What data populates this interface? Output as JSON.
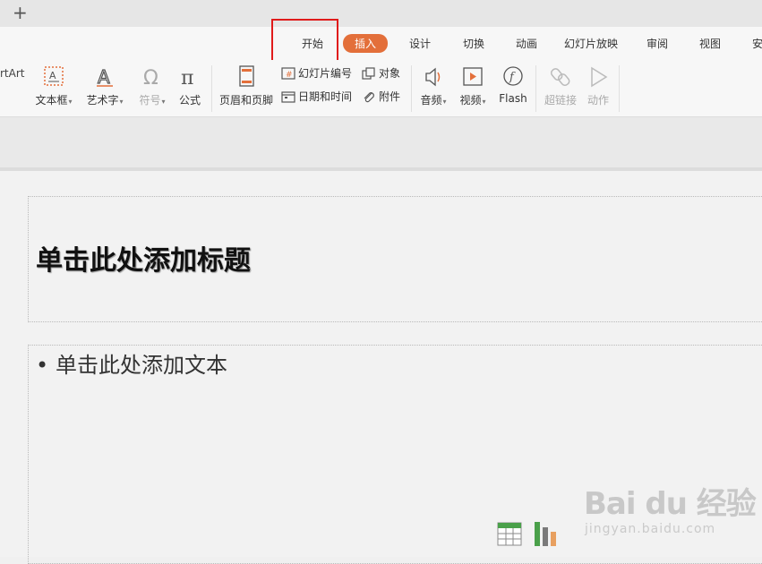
{
  "tabbar": {
    "new_tab_symbol": "+"
  },
  "ribbon_tabs": [
    "开始",
    "插入",
    "设计",
    "切换",
    "动画",
    "幻灯片放映",
    "审阅",
    "视图",
    "安"
  ],
  "active_tab": "插入",
  "toolbar": {
    "wordart_partial": "rtArt",
    "textbox": "文本框",
    "art_text": "艺术字",
    "symbol": "符号",
    "formula": "公式",
    "header_footer": "页眉和页脚",
    "slide_number": "幻灯片编号",
    "date_time": "日期和时间",
    "object": "对象",
    "attachment": "附件",
    "audio": "音频",
    "video": "视频",
    "flash": "Flash",
    "hyperlink": "超链接",
    "action": "动作"
  },
  "slide": {
    "title_placeholder": "单击此处添加标题",
    "body_placeholder": "单击此处添加文本",
    "bullet": "•"
  },
  "watermark": {
    "main": "Bai du 经验",
    "sub": "jingyan.baidu.com"
  },
  "colors": {
    "accent": "#e36f3a",
    "highlight_box": "#e01b1b"
  }
}
